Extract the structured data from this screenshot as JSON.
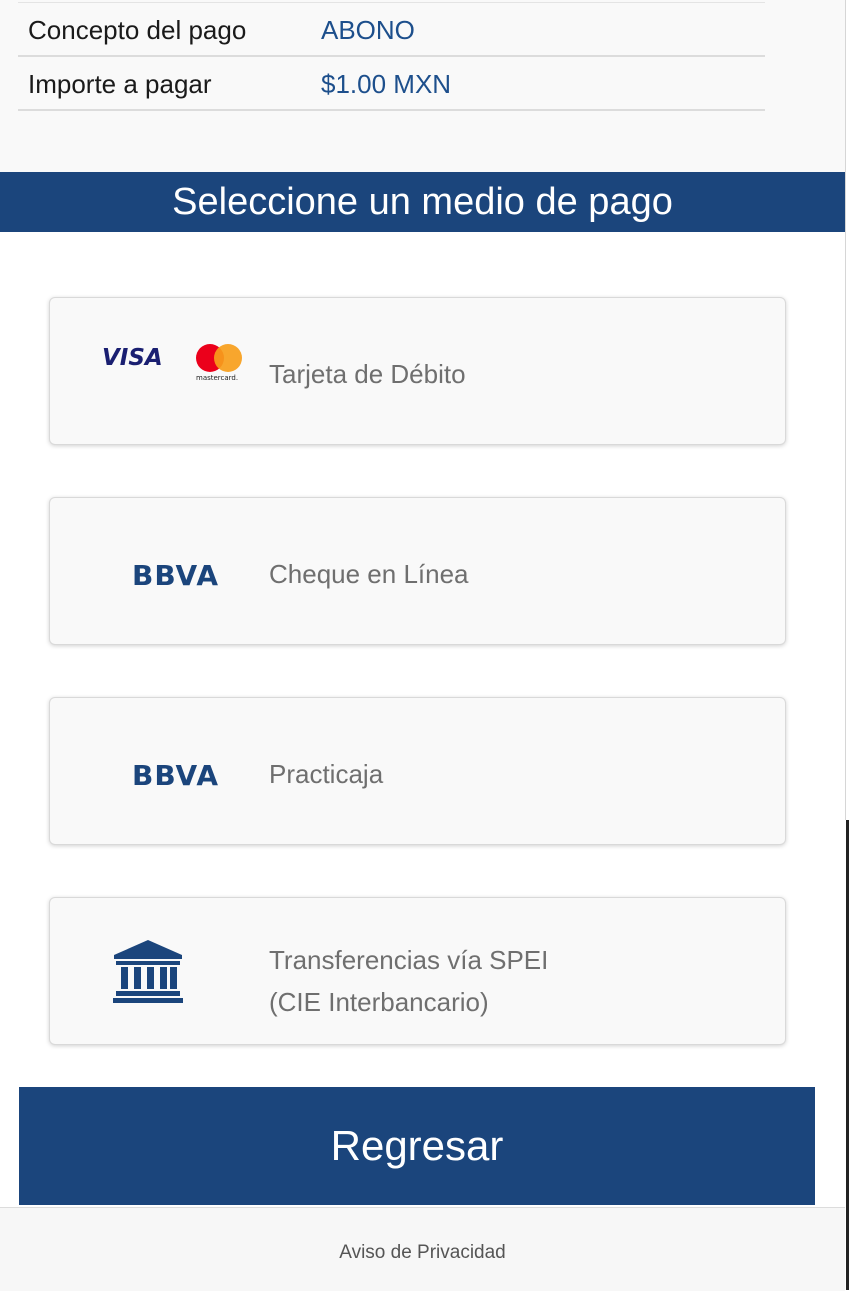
{
  "summary": {
    "rows": [
      {
        "label": "Concepto del pago",
        "value": "ABONO"
      },
      {
        "label": "Importe a pagar",
        "value": "$1.00 MXN"
      }
    ]
  },
  "section_title": "Seleccione un medio de pago",
  "payment_methods": [
    {
      "label": "Tarjeta de Débito",
      "logo": "visa-mastercard-logo"
    },
    {
      "label": "Cheque en Línea",
      "logo": "bbva-logo"
    },
    {
      "label": "Practicaja",
      "logo": "bbva-logo"
    },
    {
      "label_line1": "Transferencias vía SPEI",
      "label_line2": "(CIE Interbancario)",
      "logo": "bank-building-icon"
    }
  ],
  "logos": {
    "visa_text": "VISA",
    "mastercard_text": "mastercard.",
    "bbva_text": "BBVA"
  },
  "back_button": "Regresar",
  "footer": {
    "privacy_link": "Aviso de Privacidad"
  },
  "colors": {
    "brand_blue": "#1b457c",
    "value_blue": "#1d4f8c",
    "mc_red": "#eb001b",
    "mc_orange": "#f79e1b"
  }
}
